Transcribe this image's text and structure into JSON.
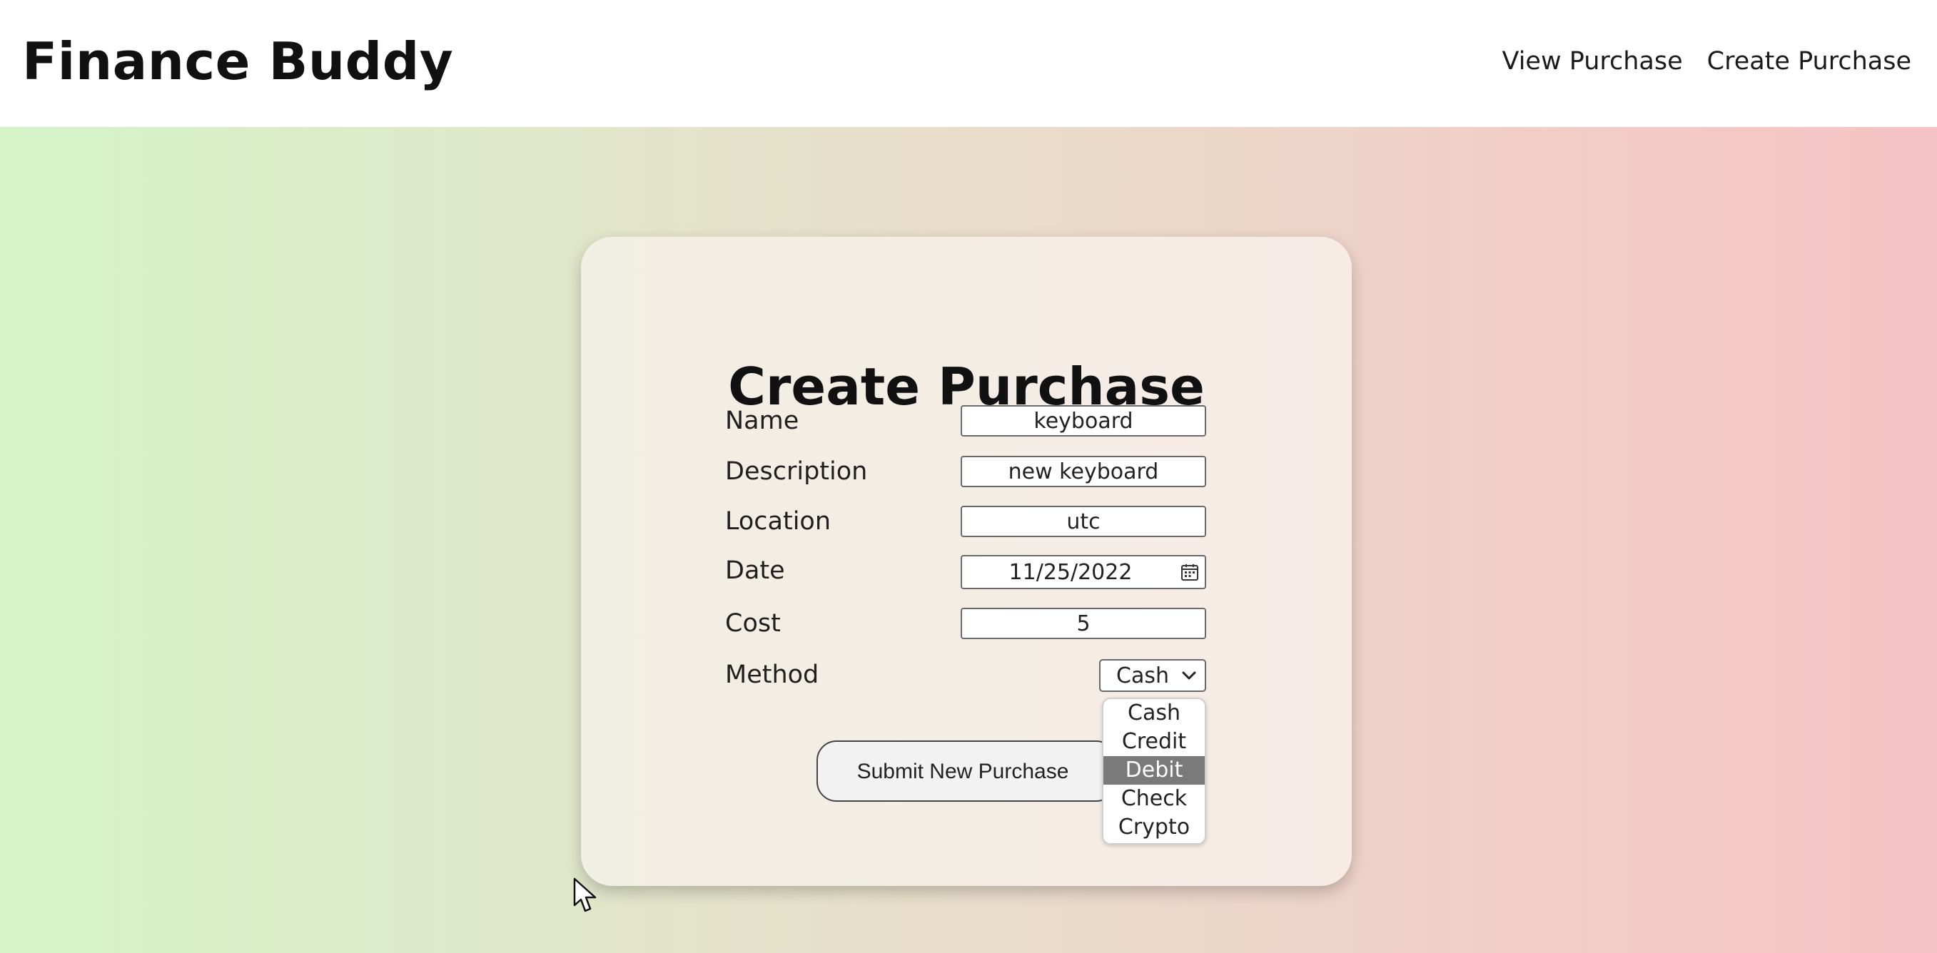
{
  "app": {
    "title": "Finance Buddy"
  },
  "nav": {
    "view_purchase": "View Purchase",
    "create_purchase": "Create Purchase"
  },
  "form": {
    "title": "Create Purchase",
    "fields": [
      {
        "label": "Name",
        "value": "keyboard"
      },
      {
        "label": "Description",
        "value": "new keyboard"
      },
      {
        "label": "Location",
        "value": "utc"
      },
      {
        "label": "Date",
        "value": "11/25/2022"
      },
      {
        "label": "Cost",
        "value": "5"
      }
    ],
    "method": {
      "label": "Method",
      "selected": "Cash",
      "options": [
        "Cash",
        "Credit",
        "Debit",
        "Check",
        "Crypto"
      ],
      "highlighted": "Debit"
    },
    "submit_label": "Submit New Purchase"
  },
  "colors": {
    "gradient_left": "#d4f4c8",
    "gradient_mid": "#e9ddca",
    "gradient_right": "#f6c3c4",
    "card_left": "#f1efe3",
    "card_right": "#f7ebe6",
    "dropdown_highlight": "#7a7a7a"
  },
  "icons": {
    "date": "calendar-icon",
    "select": "chevron-down-icon",
    "cursor": "mouse-pointer-icon"
  }
}
